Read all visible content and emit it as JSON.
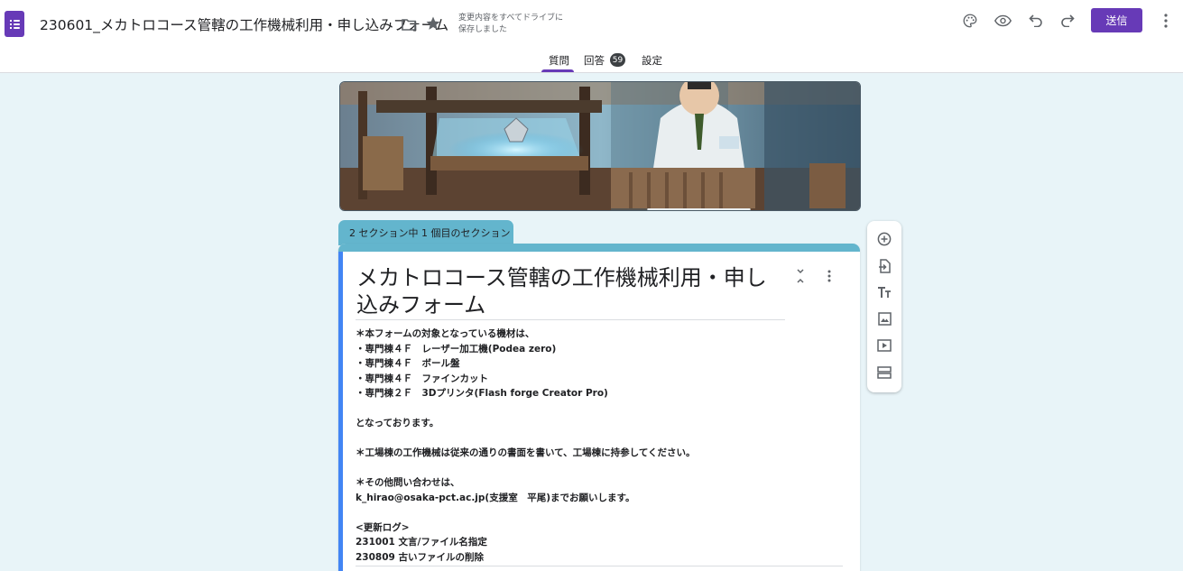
{
  "header": {
    "app_icon": "google-forms-icon",
    "title": "230601_メカトロコース管轄の工作機械利用・申し込みフォーム",
    "save_status_line1": "変更内容をすべてドライブに",
    "save_status_line2": "保存しました",
    "send_label": "送信",
    "accent_color": "#673ab7"
  },
  "tabs": {
    "questions": "質問",
    "responses": "回答",
    "responses_count": "59",
    "settings": "設定",
    "active": "questions"
  },
  "section": {
    "label": "2 セクション中 1 個目のセクション",
    "color": "#63b5cd"
  },
  "form": {
    "title_line1": "メカトロコース管轄の工作機械利用・申し",
    "title_line2": "込みフォーム",
    "description": [
      "＊本フォームの対象となっている機材は、",
      "・専門棟４Ｆ　レーザー加工機(Podea zero)",
      "・専門棟４Ｆ　ボール盤",
      "・専門棟４Ｆ　ファインカット",
      "・専門棟２Ｆ　3Dプリンタ(Flash forge Creator Pro)",
      "",
      "となっております。",
      "",
      "＊工場棟の工作機械は従来の通りの書面を書いて、工場棟に持参してください。",
      "",
      "＊その他問い合わせは、",
      "k_hirao@osaka-pct.ac.jp(支援室　平尾)までお願いします。",
      "",
      "<更新ログ>",
      "231001 文言/ファイル名指定",
      "230809 古いファイルの削除"
    ]
  },
  "toolbar": {
    "items": [
      "add-question-icon",
      "import-questions-icon",
      "add-title-icon",
      "add-image-icon",
      "add-video-icon",
      "add-section-icon"
    ]
  }
}
